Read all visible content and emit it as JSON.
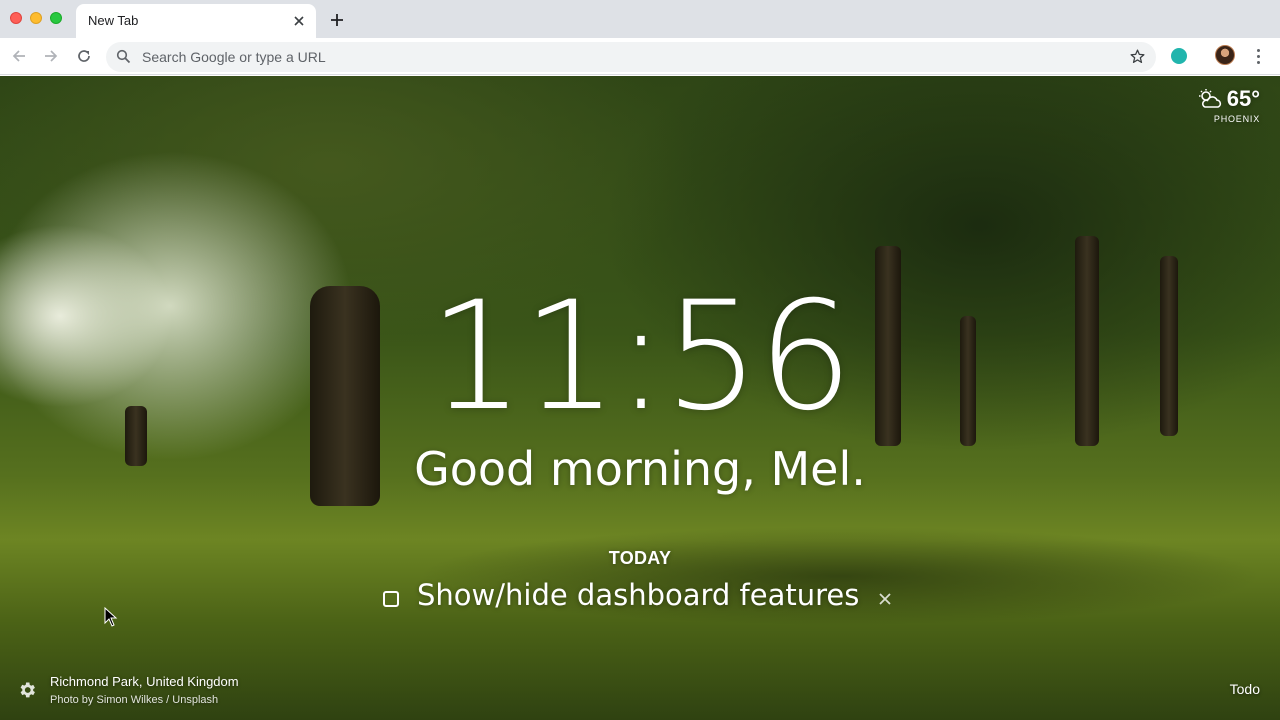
{
  "browser": {
    "tab": {
      "title": "New Tab"
    },
    "omnibox": {
      "placeholder": "Search Google or type a URL"
    }
  },
  "weather": {
    "temperature": "65°",
    "location": "PHOENIX",
    "icon": "partly-cloudy-icon"
  },
  "clock": {
    "time": "11:56"
  },
  "greeting": "Good morning, Mel.",
  "focus": {
    "label": "TODAY",
    "task": "Show/hide dashboard features"
  },
  "photo": {
    "location": "Richmond Park, United Kingdom",
    "credit": "Photo by Simon Wilkes / Unsplash"
  },
  "footer": {
    "todo_label": "Todo"
  },
  "colors": {
    "text": "#ffffff",
    "accent_extension": "#21b5ad",
    "tabstrip": "#dee1e6"
  }
}
